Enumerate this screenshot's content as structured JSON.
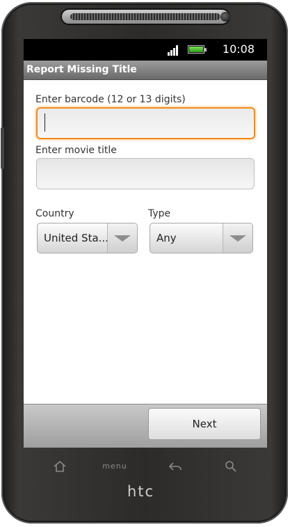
{
  "device": {
    "brand_logo": "htc"
  },
  "status_bar": {
    "time": "10:08",
    "icons": [
      "signal-icon",
      "battery-icon"
    ],
    "battery_color": "#3cb521"
  },
  "app": {
    "title": "Report Missing Title"
  },
  "form": {
    "barcode": {
      "label": "Enter barcode (12 or 13 digits)",
      "value": "",
      "focused": true
    },
    "movie_title": {
      "label": "Enter movie title",
      "value": ""
    },
    "country": {
      "label": "Country",
      "value": "United Sta..."
    },
    "type": {
      "label": "Type",
      "value": "Any"
    }
  },
  "actions": {
    "next_label": "Next"
  },
  "hardware_keys": [
    {
      "name": "home",
      "icon": "home-icon"
    },
    {
      "name": "menu",
      "label": "menu"
    },
    {
      "name": "back",
      "icon": "back-icon"
    },
    {
      "name": "search",
      "icon": "search-icon"
    }
  ],
  "colors": {
    "focus_accent": "#f08c1e",
    "title_bar": "#8a8a8a"
  }
}
